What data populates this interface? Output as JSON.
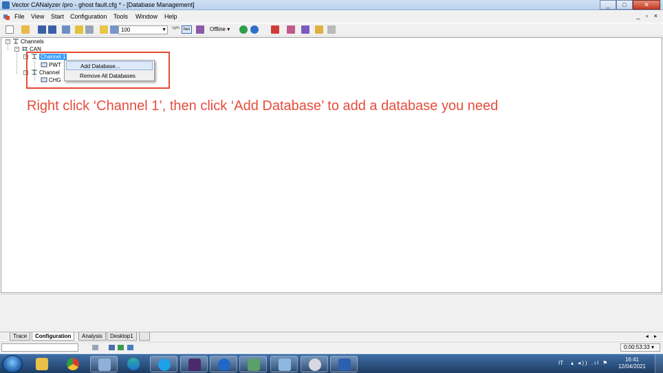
{
  "window": {
    "title": "Vector CANalyzer /pro  - ghost fault.cfg * - [Database Management]",
    "controls": {
      "minimize": "_",
      "maximize": "□",
      "close": "✕"
    },
    "mdi_controls": "_ ▫ ×"
  },
  "menubar": {
    "items": [
      "File",
      "View",
      "Start",
      "Configuration",
      "Tools",
      "Window",
      "Help"
    ]
  },
  "toolbar": {
    "zoom_value": "100",
    "sym_label": "sym",
    "hex_label": "hex",
    "mode_label": "Offline",
    "mode_arrow": "▾"
  },
  "tree": {
    "root": "Channels",
    "bus": "CAN",
    "channel1": "Channel 1",
    "channel1_db": "PWT",
    "channel2": "Channel",
    "channel2_db": "CHG"
  },
  "context_menu": {
    "items": [
      "Add Database...",
      "Remove All Databases"
    ]
  },
  "annotation": "Right click ‘Channel 1’, then click ‘Add Database’ to add a database you need",
  "tabs": [
    "Trace",
    "Configuration",
    "Analysis",
    "Desktop1"
  ],
  "tab_arrows": "◂ ▸",
  "statusbar": {
    "time": "0:00:53:33 ▾"
  },
  "taskbar": {
    "language": "IT",
    "tray_icons": "▴ ◂)) .ıl ⚑",
    "clock_time": "16:41",
    "clock_date": "12/04/2021"
  },
  "colors": {
    "annotation": "#e54c3b",
    "highlight_box": "#e64a2e",
    "selection": "#3399ff"
  }
}
